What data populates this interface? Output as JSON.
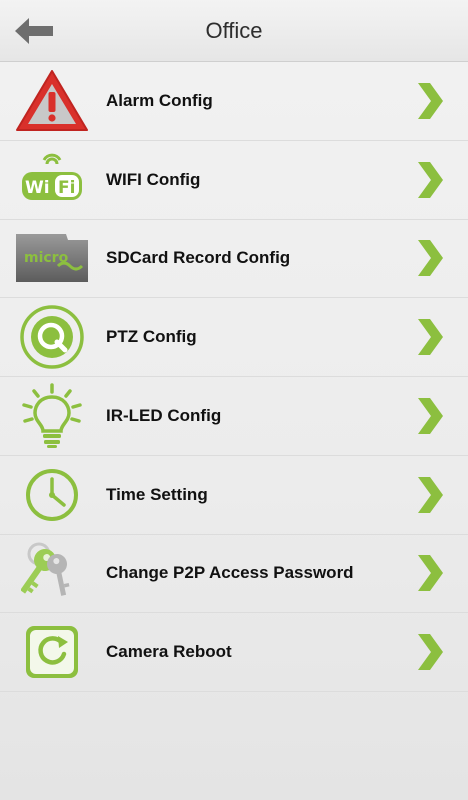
{
  "header": {
    "title": "Office",
    "back_icon": "back-arrow-icon"
  },
  "menu": {
    "items": [
      {
        "label": "Alarm Config",
        "icon": "alarm-warning-icon"
      },
      {
        "label": "WIFI Config",
        "icon": "wifi-icon"
      },
      {
        "label": "SDCard Record Config",
        "icon": "sd-card-icon",
        "icon_text": "micro"
      },
      {
        "label": "PTZ Config",
        "icon": "ptz-icon"
      },
      {
        "label": "IR-LED Config",
        "icon": "lightbulb-icon"
      },
      {
        "label": "Time Setting",
        "icon": "clock-icon"
      },
      {
        "label": "Change P2P Access Password",
        "icon": "keys-icon"
      },
      {
        "label": "Camera Reboot",
        "icon": "reboot-icon"
      }
    ]
  },
  "colors": {
    "accent_green": "#8cbf3f",
    "alarm_red": "#d9302b",
    "arrow_gray": "#6e6e6e"
  }
}
